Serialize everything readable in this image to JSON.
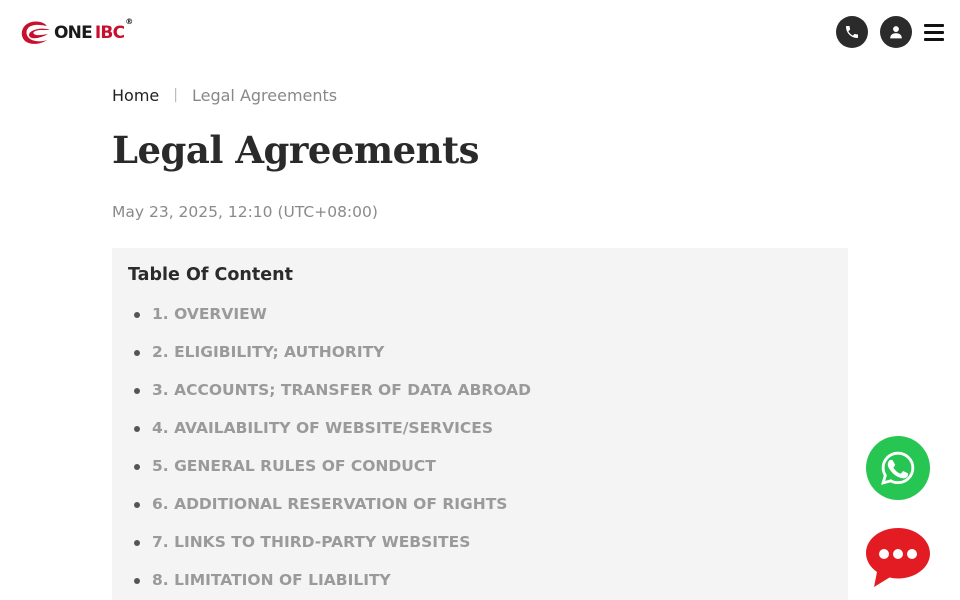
{
  "header": {
    "logo": {
      "text_one": "ONE",
      "text_ibc": "IBC",
      "reg_mark": "®"
    },
    "icons": {
      "phone": "phone-icon",
      "user": "user-icon",
      "menu": "hamburger-menu-icon"
    }
  },
  "breadcrumb": {
    "home": "Home",
    "separator": "|",
    "current": "Legal Agreements"
  },
  "page": {
    "title": "Legal Agreements",
    "date": "May 23, 2025, 12:10 (UTC+08:00)"
  },
  "toc": {
    "title": "Table Of Content",
    "items": [
      "1. OVERVIEW",
      "2. ELIGIBILITY; AUTHORITY",
      "3. ACCOUNTS; TRANSFER OF DATA ABROAD",
      "4. AVAILABILITY OF WEBSITE/SERVICES",
      "5. GENERAL RULES OF CONDUCT",
      "6. ADDITIONAL RESERVATION OF RIGHTS",
      "7. LINKS TO THIRD-PARTY WEBSITES",
      "8. LIMITATION OF LIABILITY"
    ]
  },
  "floating": {
    "whatsapp_icon": "whatsapp-icon",
    "chat_icon": "chat-bubble-icon"
  },
  "colors": {
    "brand_red": "#c8102e",
    "whatsapp_green": "#27c653",
    "chat_red": "#e31b23",
    "toc_background": "#f4f4f4"
  }
}
